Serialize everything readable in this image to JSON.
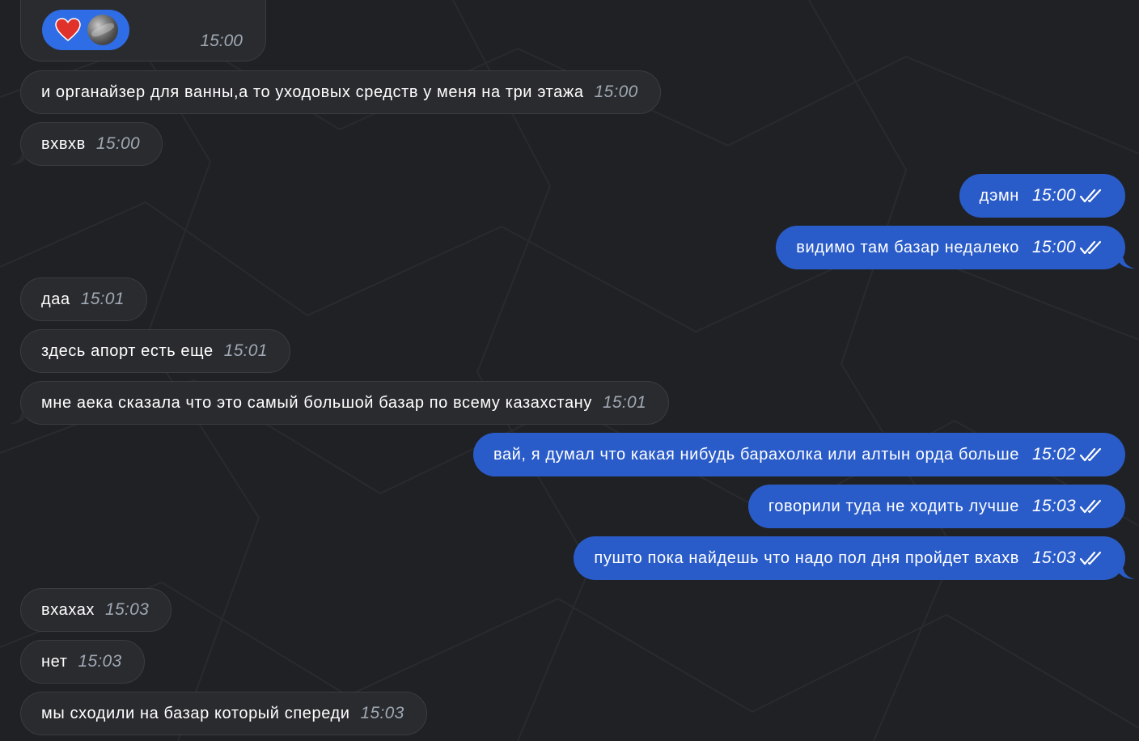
{
  "reaction_message": {
    "reaction": "heart",
    "time": "15:00"
  },
  "messages": [
    {
      "dir": "in",
      "text": "и органайзер для ванны,а то уходовых средств у меня на три этажа",
      "time": "15:00"
    },
    {
      "dir": "in",
      "text": "вхвхв",
      "time": "15:00"
    },
    {
      "dir": "out",
      "text": "дэмн",
      "time": "15:00",
      "status": "read"
    },
    {
      "dir": "out",
      "text": "видимо там базар недалеко",
      "time": "15:00",
      "status": "read"
    },
    {
      "dir": "in",
      "text": "даа",
      "time": "15:01"
    },
    {
      "dir": "in",
      "text": "здесь апорт есть еще",
      "time": "15:01"
    },
    {
      "dir": "in",
      "text": "мне аека сказала что это самый большой базар по всему казахстану",
      "time": "15:01"
    },
    {
      "dir": "out",
      "text": "вай, я думал что какая нибудь барахолка или алтын орда больше",
      "time": "15:02",
      "status": "read"
    },
    {
      "dir": "out",
      "text": "говорили туда не ходить лучше",
      "time": "15:03",
      "status": "read"
    },
    {
      "dir": "out",
      "text": "пушто пока найдешь что надо пол дня пройдет вхахв",
      "time": "15:03",
      "status": "read"
    },
    {
      "dir": "in",
      "text": "вхахах",
      "time": "15:03"
    },
    {
      "dir": "in",
      "text": "нет",
      "time": "15:03"
    },
    {
      "dir": "in",
      "text": "мы сходили на базар который спереди",
      "time": "15:03"
    }
  ],
  "colors": {
    "background": "#1f2124",
    "incoming_bubble": "#2a2b2e",
    "outgoing_bubble": "#2a5cc9",
    "reaction_pill": "#2f6de6",
    "heart": "#e0312b",
    "incoming_time": "#9fa8b4"
  },
  "icons": {
    "reaction": "heart-icon",
    "avatar": "reactor-avatar",
    "read_status": "double-check-icon"
  }
}
